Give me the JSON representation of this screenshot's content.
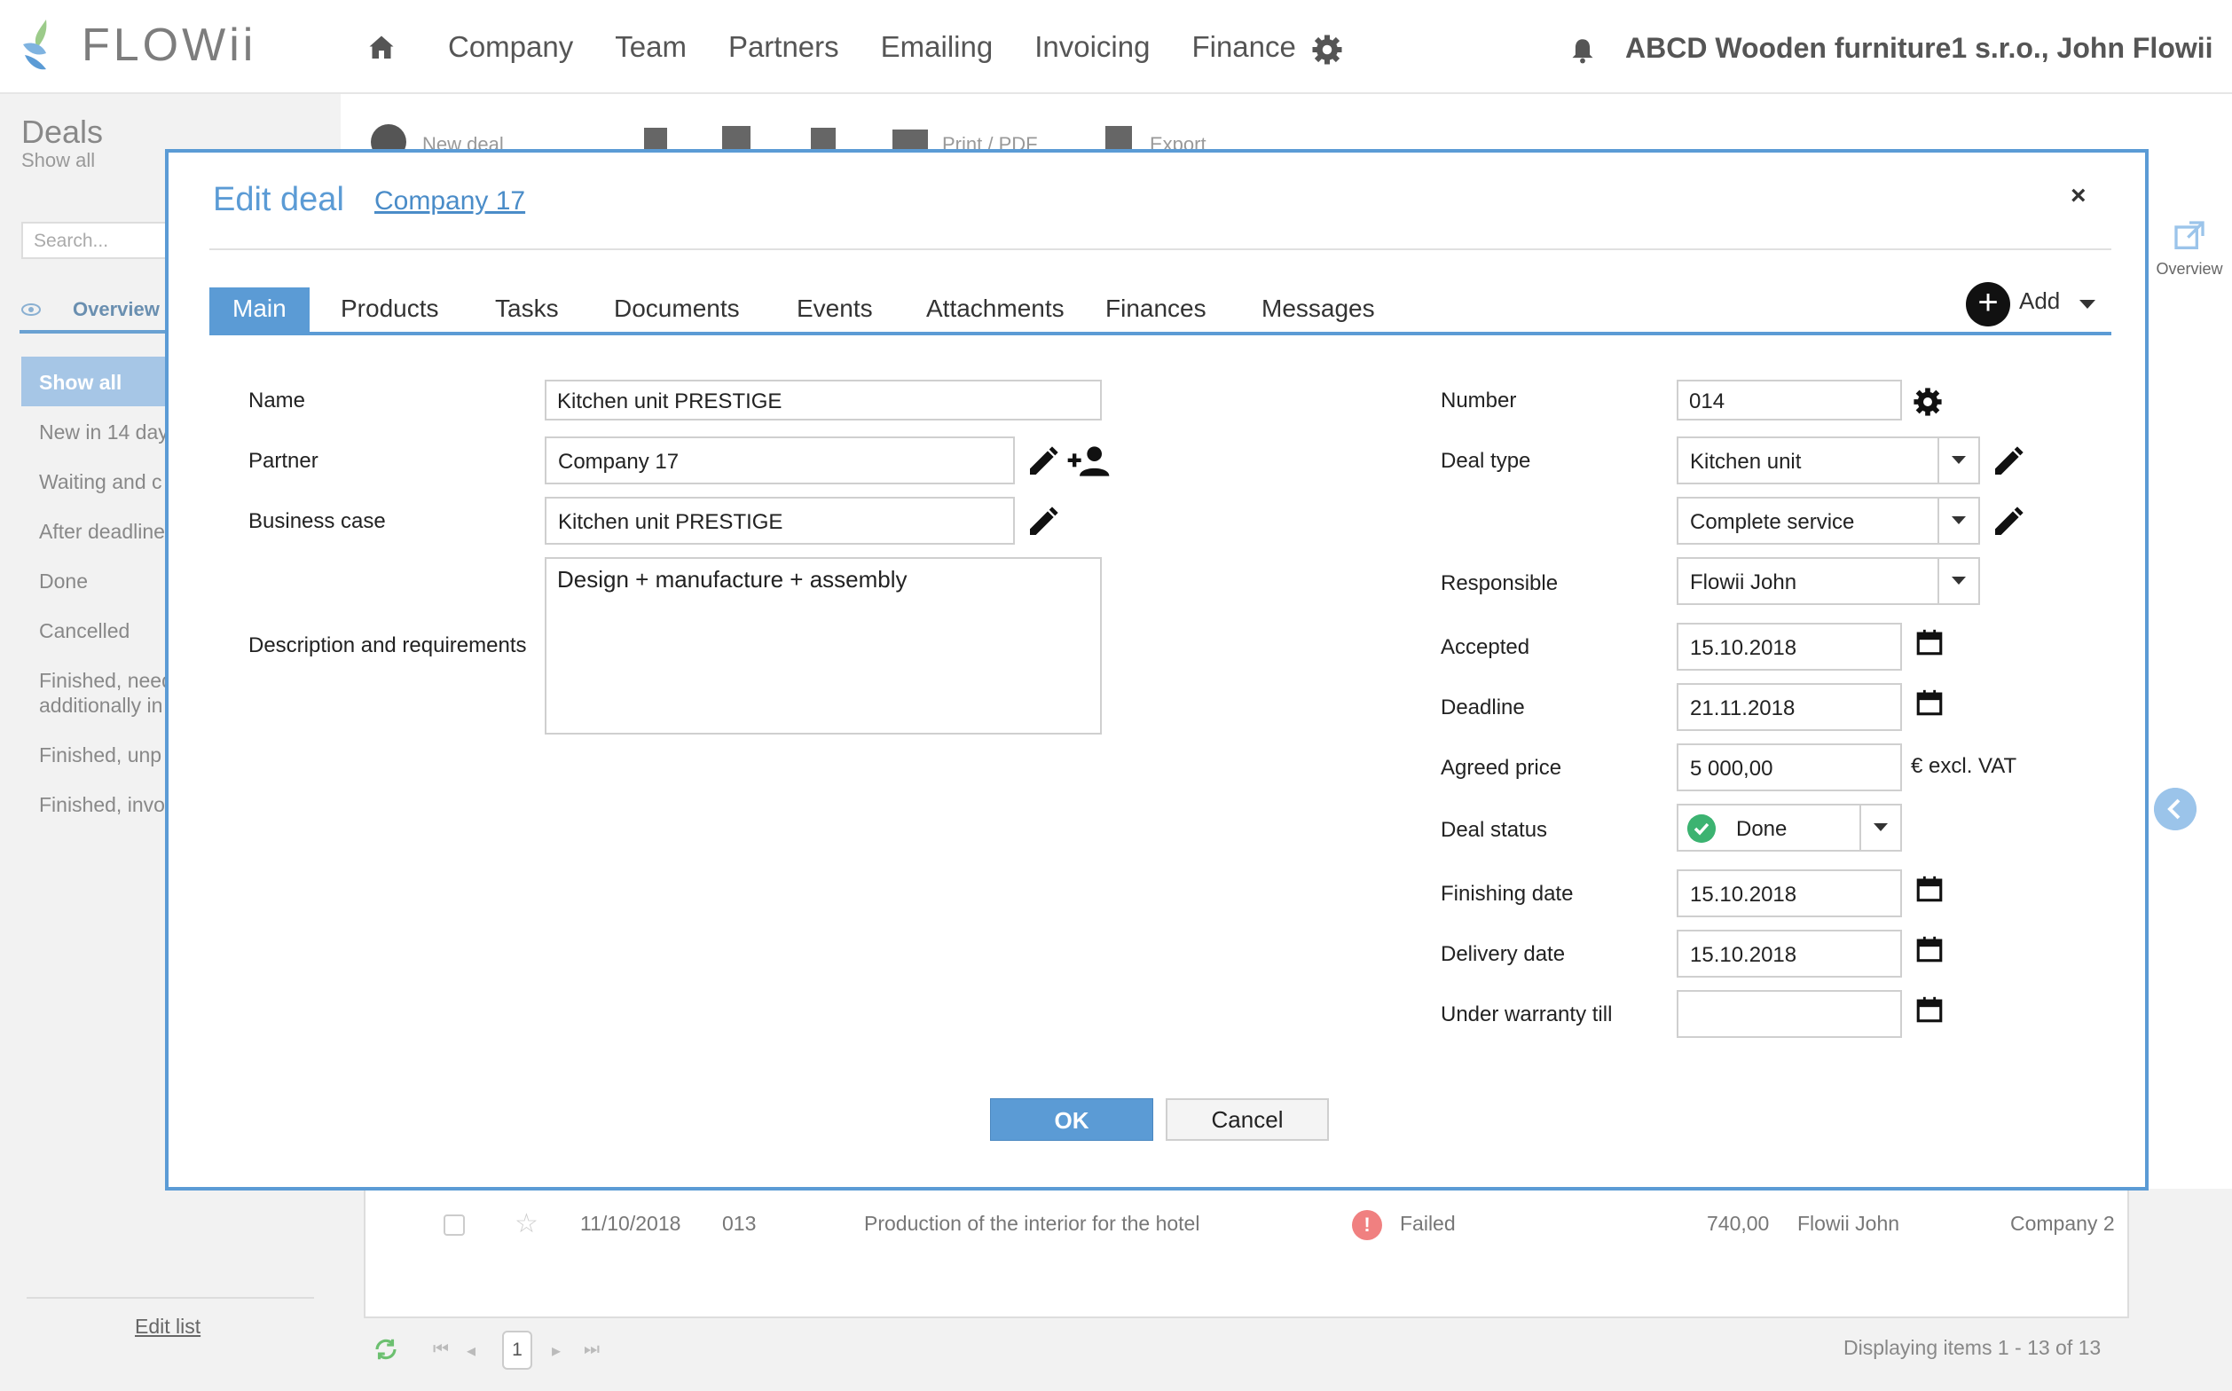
{
  "app": {
    "brand": "FLOWii",
    "nav": [
      "Company",
      "Team",
      "Partners",
      "Emailing",
      "Invoicing",
      "Finance"
    ],
    "account": "ABCD Wooden furniture1 s.r.o., John Flowii"
  },
  "left_panel": {
    "title": "Deals",
    "subtitle": "Show all",
    "search_placeholder": "Search...",
    "overview_tab": "Overview",
    "show_all": "Show all",
    "filters": [
      "New in 14 day",
      "Waiting and c",
      "After deadline",
      "Done",
      "Cancelled",
      "Finished, need",
      "additionally in",
      "Finished, unp",
      "Finished, invo"
    ],
    "edit_list": "Edit list"
  },
  "toolbar": {
    "new_deal": "New deal",
    "print": "Print / PDF",
    "export": "Export"
  },
  "right_panel": {
    "overview": "Overview"
  },
  "grid": {
    "row": {
      "date": "11/10/2018",
      "number": "013",
      "name": "Production of the interior for the hotel",
      "status": "Failed",
      "amount": "740,00",
      "responsible": "Flowii John",
      "company": "Company 2"
    },
    "page": "1",
    "displaying": "Displaying items 1 - 13 of 13"
  },
  "modal": {
    "title": "Edit deal",
    "company_link": "Company 17",
    "close": "×",
    "tabs": [
      "Main",
      "Products",
      "Tasks",
      "Documents",
      "Events",
      "Attachments",
      "Finances",
      "Messages"
    ],
    "add_label": "Add",
    "left_form": {
      "name_label": "Name",
      "name_value": "Kitchen unit PRESTIGE",
      "partner_label": "Partner",
      "partner_value": "Company 17",
      "business_case_label": "Business case",
      "business_case_value": "Kitchen unit PRESTIGE",
      "description_label": "Description and requirements",
      "description_value": "Design + manufacture + assembly"
    },
    "right_form": {
      "number_label": "Number",
      "number_value": "014",
      "deal_type_label": "Deal type",
      "deal_type_value": "Kitchen unit",
      "service_value": "Complete service",
      "responsible_label": "Responsible",
      "responsible_value": "Flowii John",
      "accepted_label": "Accepted",
      "accepted_value": "15.10.2018",
      "deadline_label": "Deadline",
      "deadline_value": "21.11.2018",
      "agreed_price_label": "Agreed price",
      "agreed_price_value": "5 000,00",
      "agreed_price_suffix": "€ excl. VAT",
      "deal_status_label": "Deal status",
      "deal_status_value": "Done",
      "finishing_date_label": "Finishing date",
      "finishing_date_value": "15.10.2018",
      "delivery_date_label": "Delivery date",
      "delivery_date_value": "15.10.2018",
      "warranty_label": "Under warranty till",
      "warranty_value": ""
    },
    "ok": "OK",
    "cancel": "Cancel"
  },
  "colors": {
    "accent": "#5b9bd5",
    "status_done": "#3cb371",
    "status_failed": "#f08080"
  }
}
